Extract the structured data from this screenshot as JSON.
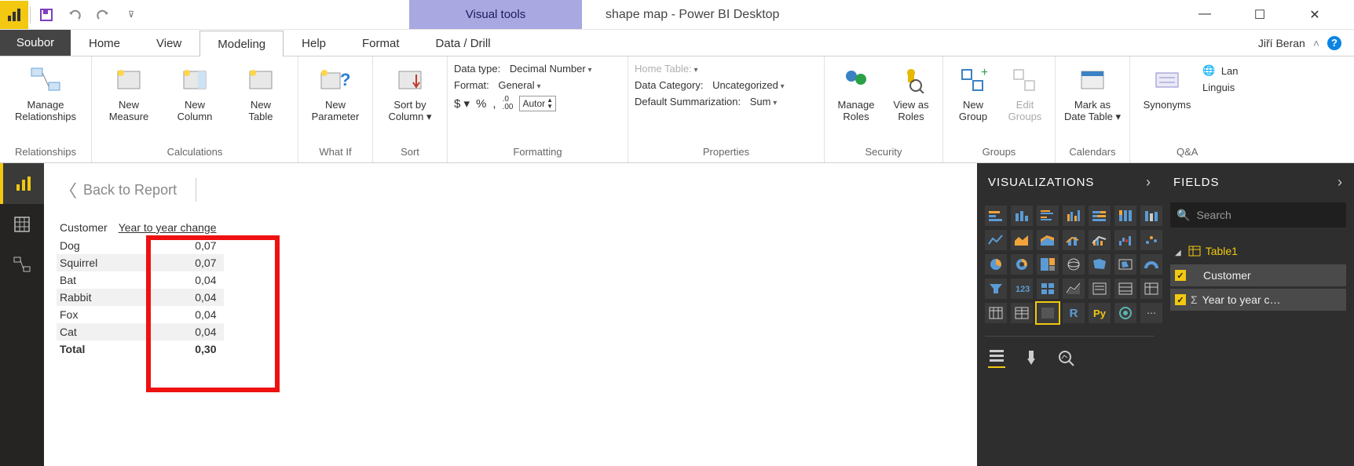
{
  "titlebar": {
    "contextual_tab": "Visual tools",
    "doc_title": "shape map - Power BI Desktop"
  },
  "tabs": {
    "file": "Soubor",
    "items": [
      "Home",
      "View",
      "Modeling",
      "Help",
      "Format",
      "Data / Drill"
    ],
    "active_index": 2,
    "user": "Jiří Beran"
  },
  "ribbon": {
    "relationships": {
      "manage": "Manage\nRelationships",
      "group": "Relationships"
    },
    "calculations": {
      "measure": "New\nMeasure",
      "column": "New\nColumn",
      "table": "New\nTable",
      "group": "Calculations"
    },
    "whatif": {
      "param": "New\nParameter",
      "group": "What If"
    },
    "sort": {
      "btn": "Sort by\nColumn ▾",
      "group": "Sort"
    },
    "formatting": {
      "dtype_label": "Data type:",
      "dtype_val": "Decimal Number",
      "format_label": "Format:",
      "format_val": "General",
      "dollar": "$ ▾",
      "pct": "%",
      "comma": ",",
      "dec": ".0\n.00",
      "auto": "Autor",
      "group": "Formatting"
    },
    "properties": {
      "home_label": "Home Table:",
      "cat_label": "Data Category:",
      "cat_val": "Uncategorized",
      "sum_label": "Default Summarization:",
      "sum_val": "Sum",
      "group": "Properties"
    },
    "security": {
      "manage": "Manage\nRoles",
      "viewas": "View as\nRoles",
      "group": "Security"
    },
    "groups": {
      "newg": "New\nGroup",
      "editg": "Edit\nGroups",
      "group": "Groups"
    },
    "calendars": {
      "mark": "Mark as\nDate Table ▾",
      "group": "Calendars"
    },
    "qa": {
      "syn": "Synonyms",
      "lan": "Lan",
      "ling": "Linguis",
      "group": "Q&A"
    }
  },
  "canvas": {
    "back": "Back to Report",
    "headers": [
      "Customer",
      "Year to year change"
    ],
    "rows": [
      {
        "c": "Dog",
        "v": "0,07"
      },
      {
        "c": "Squirrel",
        "v": "0,07"
      },
      {
        "c": "Bat",
        "v": "0,04"
      },
      {
        "c": "Rabbit",
        "v": "0,04"
      },
      {
        "c": "Fox",
        "v": "0,04"
      },
      {
        "c": "Cat",
        "v": "0,04"
      }
    ],
    "total_label": "Total",
    "total_value": "0,30"
  },
  "panes": {
    "viz_title": "VISUALIZATIONS",
    "fields_title": "FIELDS",
    "search_placeholder": "Search",
    "table_name": "Table1",
    "fields": [
      "Customer",
      "Year to year c…"
    ]
  }
}
